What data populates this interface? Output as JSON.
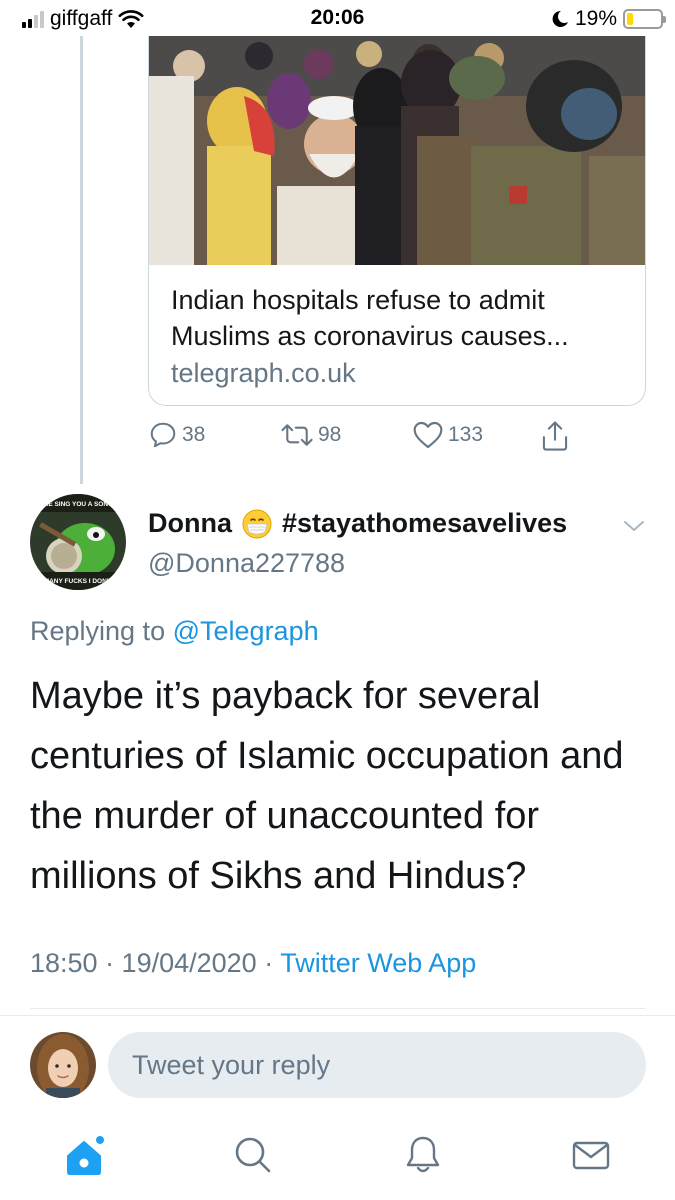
{
  "status_bar": {
    "carrier": "giffgaff",
    "time": "20:06",
    "battery_percent": "19%",
    "battery_level": 0.19,
    "signal_bars": 2
  },
  "link_card": {
    "title": "Indian hospitals refuse to admit Muslims as coronavirus causes...",
    "domain": "telegraph.co.uk"
  },
  "previous_tweet_actions": {
    "replies": "38",
    "retweets": "98",
    "likes": "133"
  },
  "tweet": {
    "display_name": "Donna",
    "hashtag_name": "#stayathomesavelives",
    "handle": "@Donna227788",
    "avatar_caption_top": "ME SING YOU A SONG",
    "avatar_caption_bottom": "MANY FUCKS I DON'T",
    "replying_prefix": "Replying to",
    "replying_to": "@Telegraph",
    "text": "Maybe it’s payback for several centuries of Islamic occupation and the murder of unaccounted for millions of Sikhs and Hindus?",
    "timestamp": "18:50 · 19/04/2020 ·",
    "source": "Twitter Web App"
  },
  "reply": {
    "placeholder": "Tweet your reply"
  },
  "colors": {
    "accent": "#1da1f2",
    "link": "#1b95e0",
    "secondary_text": "#657786",
    "divider": "#e6ecf0"
  },
  "tabbar": {
    "items": [
      "home-icon",
      "search-icon",
      "notifications-icon",
      "messages-icon"
    ]
  }
}
